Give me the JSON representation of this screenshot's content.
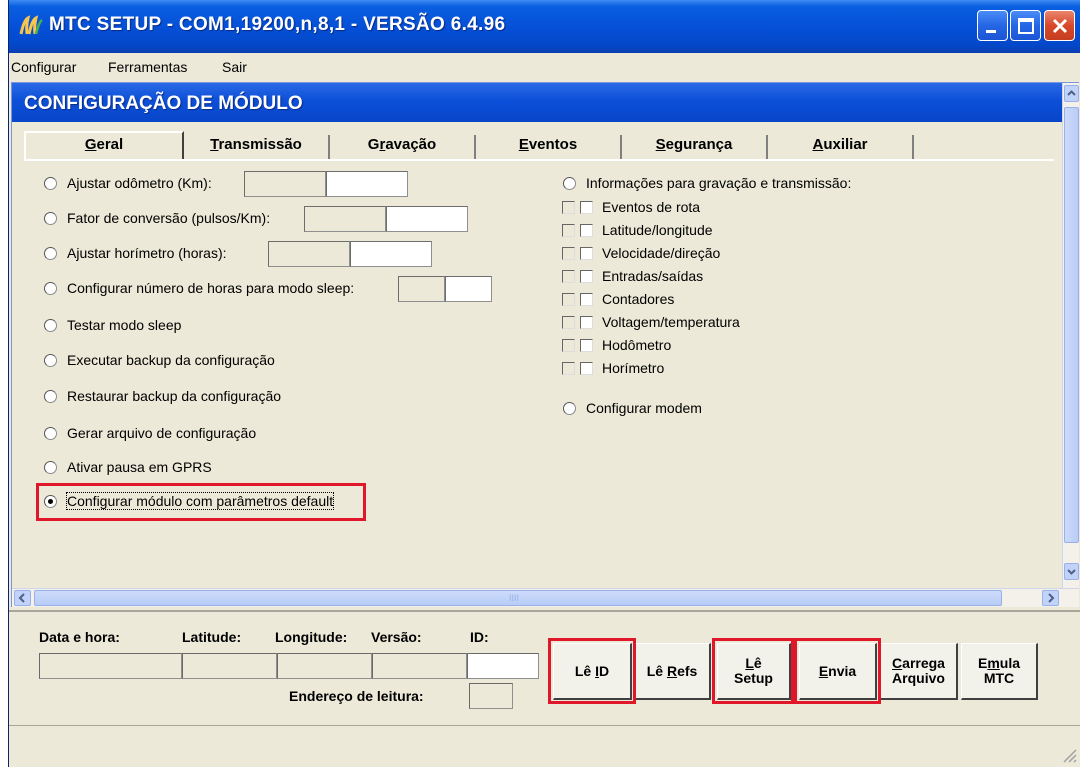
{
  "window": {
    "title": "MTC SETUP - COM1,19200,n,8,1 - VERSÃO 6.4.96"
  },
  "menu": [
    "Configurar",
    "Ferramentas",
    "Sair"
  ],
  "module": {
    "title": "CONFIGURAÇÃO DE MÓDULO",
    "tabs": [
      {
        "u": "G",
        "rest": "eral"
      },
      {
        "u": "T",
        "rest": "ransmissão"
      },
      {
        "pre": "G",
        "u": "r",
        "rest": "avação"
      },
      {
        "u": "E",
        "rest": "ventos"
      },
      {
        "u": "S",
        "rest": "egurança"
      },
      {
        "u": "A",
        "rest": "uxiliar"
      }
    ],
    "options_left": [
      "Ajustar odômetro (Km):",
      "Fator de conversão (pulsos/Km):",
      "Ajustar horímetro (horas):",
      "Configurar número de horas para modo sleep:",
      "Testar modo sleep",
      "Executar backup da configuração",
      "Restaurar backup da configuração",
      "Gerar arquivo de configuração",
      "Ativar pausa em GPRS",
      "Configurar módulo com parâmetros default"
    ],
    "info_option": "Informações para gravação e transmissão:",
    "checkboxes": [
      "Eventos de rota",
      "Latitude/longitude",
      "Velocidade/direção",
      "Entradas/saídas",
      "Contadores",
      "Voltagem/temperatura",
      "Hodômetro",
      "Horímetro"
    ],
    "modem_option": "Configurar modem",
    "scroll_grip": "IIII"
  },
  "bottom": {
    "labels": {
      "data_hora": "Data e hora:",
      "latitude": "Latitude:",
      "longitude": "Longitude:",
      "versao": "Versão:",
      "id": "ID:",
      "endereco": "Endereço de leitura:"
    },
    "buttons": {
      "le_id": {
        "pre": "Lê ",
        "u": "I",
        "rest": "D"
      },
      "le_refs": {
        "pre": "Lê ",
        "u": "R",
        "rest": "efs"
      },
      "le_setup": {
        "line1_u": "L",
        "line1_rest": "ê",
        "line2": "Setup"
      },
      "envia": {
        "u": "E",
        "rest": "nvia"
      },
      "carrega": {
        "line1_u": "C",
        "line1_rest": "arrega",
        "line2": "Arquivo"
      },
      "emula": {
        "line1_pre": "E",
        "line1_u": "m",
        "line1_rest": "ula",
        "line2": "MTC"
      }
    }
  },
  "highlight_color": "#e0162b"
}
